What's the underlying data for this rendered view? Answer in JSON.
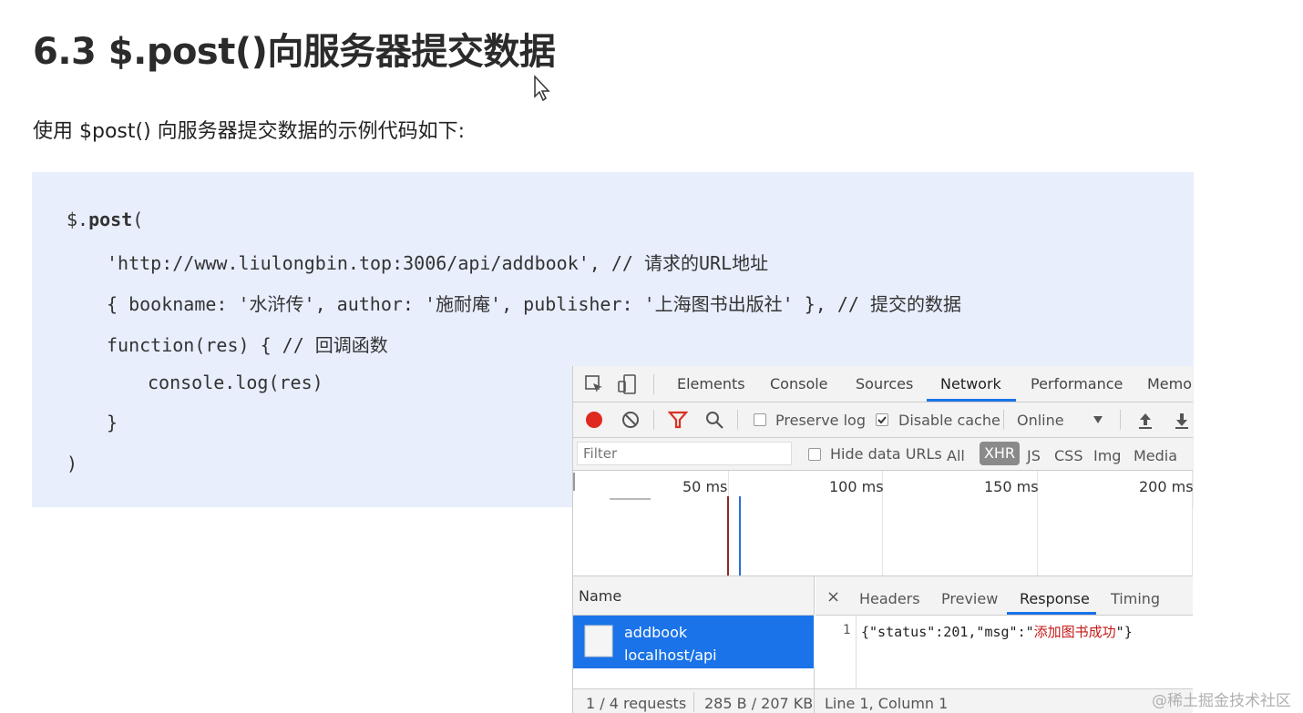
{
  "heading": "6.3 $.post()向服务器提交数据",
  "intro": "使用 $post() 向服务器提交数据的示例代码如下:",
  "code": {
    "line1_dollar": "$.",
    "line1_post": "post",
    "line1_paren": "(",
    "line2": "'http://www.liulongbin.top:3006/api/addbook', // 请求的URL地址",
    "line3": "{ bookname: '水浒传', author: '施耐庵', publisher: '上海图书出版社' }, // 提交的数据",
    "line4": "function(res) { // 回调函数",
    "line5": "console.log(res)",
    "line6": "}",
    "line7": ")"
  },
  "devtools": {
    "tabs": [
      "Elements",
      "Console",
      "Sources",
      "Network",
      "Performance",
      "Memo"
    ],
    "active_tab": "Network",
    "toolbar": {
      "preserve_log": "Preserve log",
      "disable_cache": "Disable cache",
      "throttle": "Online",
      "preserve_checked": false,
      "disable_checked": true
    },
    "filter": {
      "placeholder": "Filter",
      "hide_data_urls": "Hide data URLs",
      "types": [
        "All",
        "XHR",
        "JS",
        "CSS",
        "Img",
        "Media"
      ],
      "active_type": "XHR"
    },
    "timeline_ticks": [
      "50 ms",
      "100 ms",
      "150 ms",
      "200 ms"
    ],
    "name_header": "Name",
    "detail_close": "×",
    "detail_tabs": [
      "Headers",
      "Preview",
      "Response",
      "Timing"
    ],
    "active_detail_tab": "Response",
    "request": {
      "name": "addbook",
      "path": "localhost/api"
    },
    "response_line_number": "1",
    "response_json_prefix": "{\"status\":201,\"msg\":\"",
    "response_json_msg": "添加图书成功",
    "response_json_suffix": "\"}",
    "status_requests": "1 / 4 requests",
    "status_size": "285 B / 207 KB",
    "status_position": "Line 1, Column 1"
  },
  "watermark": "@稀土掘金技术社区",
  "colors": {
    "code_bg": "#e8eefc",
    "accent": "#1a73e8",
    "record": "#e0291f",
    "filter_icon": "#d93025"
  }
}
